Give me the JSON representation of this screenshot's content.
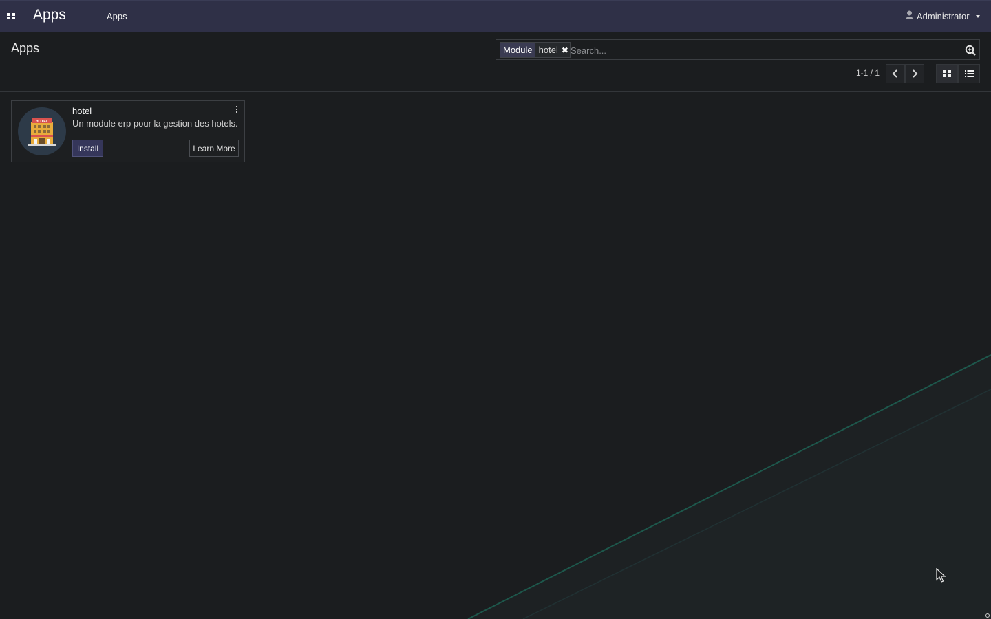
{
  "navbar": {
    "apps_menu_icon": "grid-icon",
    "brand": "Apps",
    "menu_item": "Apps",
    "user_icon": "user-icon",
    "user_name": "Administrator"
  },
  "control_panel": {
    "title": "Apps",
    "search": {
      "facet_label": "Module",
      "facet_value": "hotel",
      "facet_remove_icon": "close-icon",
      "placeholder": "Search...",
      "value": "",
      "search_icon": "magnifier-icon"
    },
    "pager": {
      "value": "1-1 / 1",
      "prev_icon": "chevron-left-icon",
      "next_icon": "chevron-right-icon"
    },
    "views": {
      "kanban_icon": "kanban-icon",
      "list_icon": "list-icon"
    }
  },
  "modules": [
    {
      "name": "hotel",
      "summary": "Un module erp pour la gestion des hotels.",
      "icon": "hotel-building-icon",
      "icon_sign": "HOTEL",
      "install_label": "Install",
      "learn_more_label": "Learn More"
    }
  ],
  "colors": {
    "navbar_bg": "#2f3047",
    "page_bg": "#1b1d1f",
    "primary_button": "#35365a",
    "accent_line": "#1e6b5a"
  }
}
